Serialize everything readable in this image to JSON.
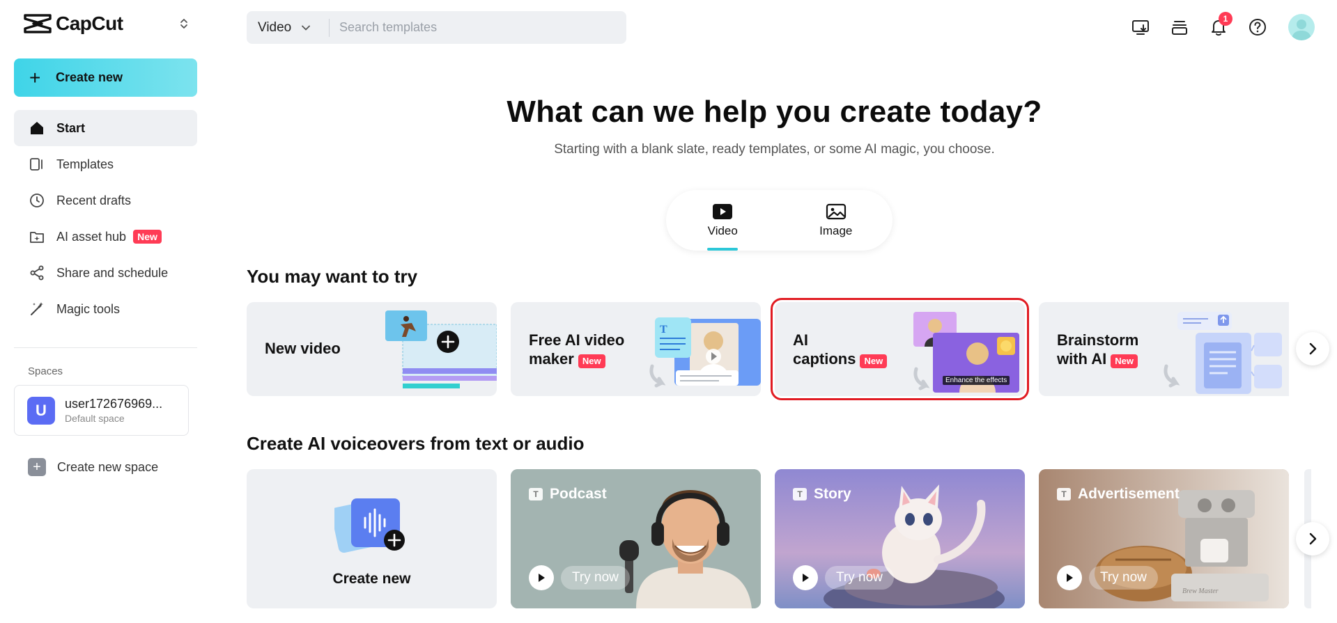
{
  "app": {
    "name": "CapCut"
  },
  "sidebar": {
    "create_label": "Create new",
    "items": [
      {
        "label": "Start",
        "icon": "home-icon",
        "active": true
      },
      {
        "label": "Templates",
        "icon": "templates-icon"
      },
      {
        "label": "Recent drafts",
        "icon": "clock-icon"
      },
      {
        "label": "AI asset hub",
        "icon": "asset-hub-icon",
        "badge": "New"
      },
      {
        "label": "Share and schedule",
        "icon": "share-icon"
      },
      {
        "label": "Magic tools",
        "icon": "magic-wand-icon"
      }
    ],
    "spaces_label": "Spaces",
    "space": {
      "initial": "U",
      "name": "user172676969...",
      "subtitle": "Default space"
    },
    "new_space_label": "Create new space"
  },
  "search": {
    "type_value": "Video",
    "placeholder": "Search templates"
  },
  "topbar": {
    "notification_count": "1"
  },
  "hero": {
    "title": "What can we help you create today?",
    "subtitle": "Starting with a blank slate, ready templates, or some AI magic, you choose.",
    "tabs": [
      {
        "label": "Video",
        "active": true
      },
      {
        "label": "Image"
      }
    ]
  },
  "try_section": {
    "title": "You may want to try",
    "cards": [
      {
        "title_line1": "New video",
        "title_line2": "",
        "badge": ""
      },
      {
        "title_line1": "Free AI video",
        "title_line2": "maker",
        "badge": "New"
      },
      {
        "title_line1": "AI",
        "title_line2": "captions",
        "badge": "New",
        "caption_text": "Enhance the effects"
      },
      {
        "title_line1": "Brainstorm",
        "title_line2": "with AI",
        "badge": "New"
      }
    ]
  },
  "voice_section": {
    "title": "Create AI voiceovers from text or audio",
    "create_label": "Create new",
    "cards": [
      {
        "label": "Podcast",
        "cta": "Try now",
        "color": "#9fb0ad"
      },
      {
        "label": "Story",
        "cta": "Try now",
        "color": "#9a93cf"
      },
      {
        "label": "Advertisement",
        "cta": "Try now",
        "color": "#b89a84"
      }
    ]
  },
  "colors": {
    "accent": "#2cc7d8",
    "badge": "#ff3b55",
    "highlight": "#e11b22"
  }
}
